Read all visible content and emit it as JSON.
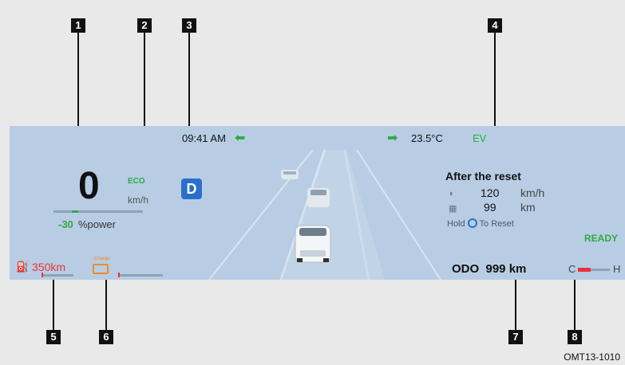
{
  "callouts": [
    "1",
    "2",
    "3",
    "4",
    "5",
    "6",
    "7",
    "8"
  ],
  "doc_code": "OMT13-1010",
  "top_bar": {
    "time": "09:41 AM",
    "temperature": "23.5°C",
    "mode": "EV"
  },
  "speed": {
    "value": "0",
    "eco": "ECO",
    "unit": "km/h",
    "power_value": "-30",
    "power_unit": "%power"
  },
  "gear": "D",
  "trip": {
    "title": "After the reset",
    "rows": [
      {
        "value": "120",
        "unit": "km/h"
      },
      {
        "value": "99",
        "unit": "km"
      }
    ],
    "hold_prefix": "Hold",
    "hold_suffix": "To Reset"
  },
  "status": {
    "ready": "READY"
  },
  "range": {
    "value": "350km",
    "charge_label": "Charge"
  },
  "odometer": {
    "text": "ODO  999 km"
  },
  "temp_gauge": {
    "cold": "C",
    "hot": "H",
    "level": 0.4
  },
  "colors": {
    "background": "#b8cde4",
    "accent_green": "#2eaa43",
    "warning_red": "#e63434",
    "warning_orange": "#f08a2a",
    "gear_blue": "#2a6fc9"
  },
  "icons": [
    "left-arrow-icon",
    "right-arrow-icon",
    "fuel-icon",
    "battery-icon",
    "car-icon",
    "speed-icon",
    "distance-icon"
  ]
}
